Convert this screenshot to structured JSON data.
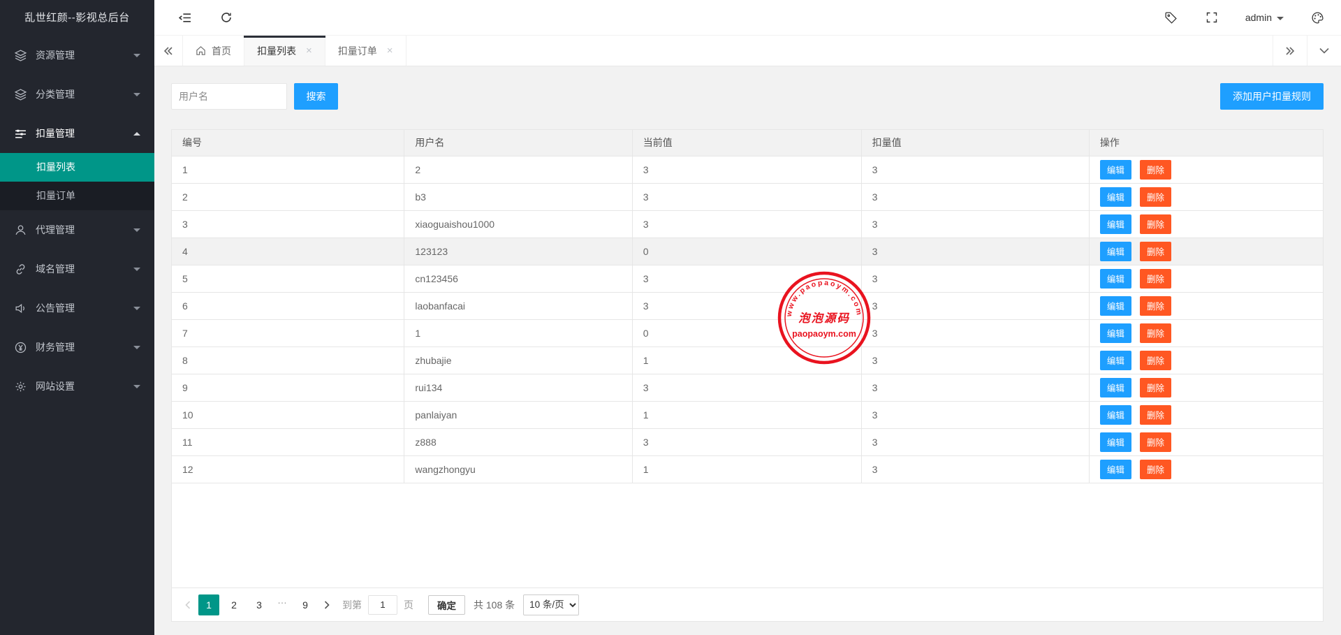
{
  "app": {
    "title": "乱世红颜--影视总后台"
  },
  "topbar": {
    "icons": [
      "collapse-menu-icon",
      "refresh-icon",
      "tag-icon",
      "fullscreen-icon",
      "theme-palette-icon"
    ],
    "admin_label": "admin"
  },
  "tabs": {
    "close_glyph": "×",
    "items": [
      {
        "label": "首页",
        "icon": "home-icon",
        "active": false,
        "closable": false
      },
      {
        "label": "扣量列表",
        "active": true,
        "closable": true
      },
      {
        "label": "扣量订单",
        "active": false,
        "closable": true
      }
    ]
  },
  "sidebar": {
    "items": [
      {
        "label": "资源管理",
        "icon": "layers-icon",
        "expanded": false
      },
      {
        "label": "分类管理",
        "icon": "layers-icon",
        "expanded": false
      },
      {
        "label": "扣量管理",
        "icon": "sliders-icon",
        "expanded": true,
        "children": [
          {
            "label": "扣量列表",
            "active": true
          },
          {
            "label": "扣量订单",
            "active": false
          }
        ]
      },
      {
        "label": "代理管理",
        "icon": "user-icon",
        "expanded": false
      },
      {
        "label": "域名管理",
        "icon": "link-icon",
        "expanded": false
      },
      {
        "label": "公告管理",
        "icon": "speaker-icon",
        "expanded": false
      },
      {
        "label": "财务管理",
        "icon": "yen-circle-icon",
        "expanded": false
      },
      {
        "label": "网站设置",
        "icon": "gear-icon",
        "expanded": false
      }
    ]
  },
  "search": {
    "placeholder": "用户名",
    "button_label": "搜索"
  },
  "actions": {
    "add_rule_label": "添加用户扣量规则"
  },
  "table": {
    "columns": [
      "编号",
      "用户名",
      "当前值",
      "扣量值",
      "操作"
    ],
    "edit_label": "编辑",
    "delete_label": "删除",
    "highlighted_row": 3,
    "rows": [
      {
        "id": "1",
        "username": "2",
        "current": "3",
        "deduct": "3"
      },
      {
        "id": "2",
        "username": "b3",
        "current": "3",
        "deduct": "3"
      },
      {
        "id": "3",
        "username": "xiaoguaishou1000",
        "current": "3",
        "deduct": "3"
      },
      {
        "id": "4",
        "username": "123123",
        "current": "0",
        "deduct": "3"
      },
      {
        "id": "5",
        "username": "cn123456",
        "current": "3",
        "deduct": "3"
      },
      {
        "id": "6",
        "username": "laobanfacai",
        "current": "3",
        "deduct": "3"
      },
      {
        "id": "7",
        "username": "1",
        "current": "0",
        "deduct": "3"
      },
      {
        "id": "8",
        "username": "zhubajie",
        "current": "1",
        "deduct": "3"
      },
      {
        "id": "9",
        "username": "rui134",
        "current": "3",
        "deduct": "3"
      },
      {
        "id": "10",
        "username": "panlaiyan",
        "current": "1",
        "deduct": "3"
      },
      {
        "id": "11",
        "username": "z888",
        "current": "3",
        "deduct": "3"
      },
      {
        "id": "12",
        "username": "wangzhongyu",
        "current": "1",
        "deduct": "3"
      }
    ]
  },
  "pagination": {
    "pages": [
      {
        "label": "1",
        "active": true
      },
      {
        "label": "2",
        "active": false
      },
      {
        "label": "3",
        "active": false
      },
      {
        "label": "…",
        "ellipsis": true
      },
      {
        "label": "9",
        "active": false
      }
    ],
    "goto_label": "到第",
    "goto_value": "1",
    "page_unit_label": "页",
    "confirm_label": "确定",
    "total_label": "共 108 条",
    "page_size_label": "10 条/页"
  },
  "watermark": {
    "arc_text": "www.paopaoym.com",
    "title": "泡泡源码",
    "subtitle": "paopaoym.com"
  },
  "colors": {
    "sidebar_bg": "#23262e",
    "submenu_bg": "#1a1d24",
    "active_teal": "#009688",
    "primary_blue": "#1e9fff",
    "danger_orange": "#ff5722",
    "content_bg": "#f2f2f2",
    "table_border": "#e6e6e6",
    "stamp_red": "#e8000d"
  }
}
